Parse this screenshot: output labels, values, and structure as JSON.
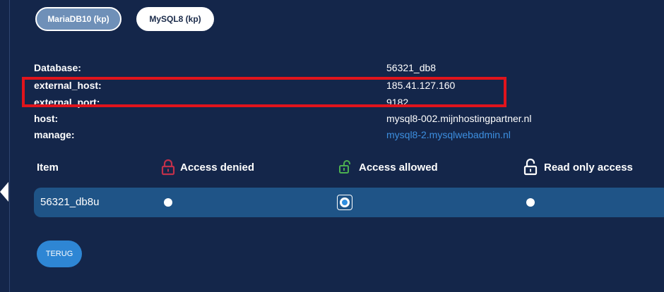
{
  "tabs": [
    {
      "label": "MariaDB10 (kp)",
      "active": true
    },
    {
      "label": "MySQL8 (kp)",
      "active": false
    }
  ],
  "info": {
    "database": {
      "label": "Database:",
      "value": "56321_db8"
    },
    "external_host": {
      "label": "external_host:",
      "value": "185.41.127.160"
    },
    "external_port": {
      "label": "external_port:",
      "value": "9182"
    },
    "host": {
      "label": "host:",
      "value": "mysql8-002.mijnhostingpartner.nl"
    },
    "manage": {
      "label": "manage:",
      "value": "mysql8-2.mysqlwebadmin.nl"
    }
  },
  "access_table": {
    "columns": {
      "item": "Item",
      "denied": "Access denied",
      "allowed": "Access allowed",
      "readonly": "Read only access"
    },
    "rows": [
      {
        "name": "56321_db8u",
        "selected": "allowed"
      }
    ]
  },
  "back_button": "TERUG",
  "colors": {
    "background": "#14264a",
    "row": "#1f5487",
    "highlight": "#e0141c",
    "link": "#3d8fe0",
    "denied_icon": "#c0304a",
    "allowed_icon": "#4caf50",
    "button": "#2e86d4"
  },
  "icons": {
    "denied": "lock-closed-icon",
    "allowed": "lock-open-icon",
    "readonly": "lock-open-icon"
  }
}
